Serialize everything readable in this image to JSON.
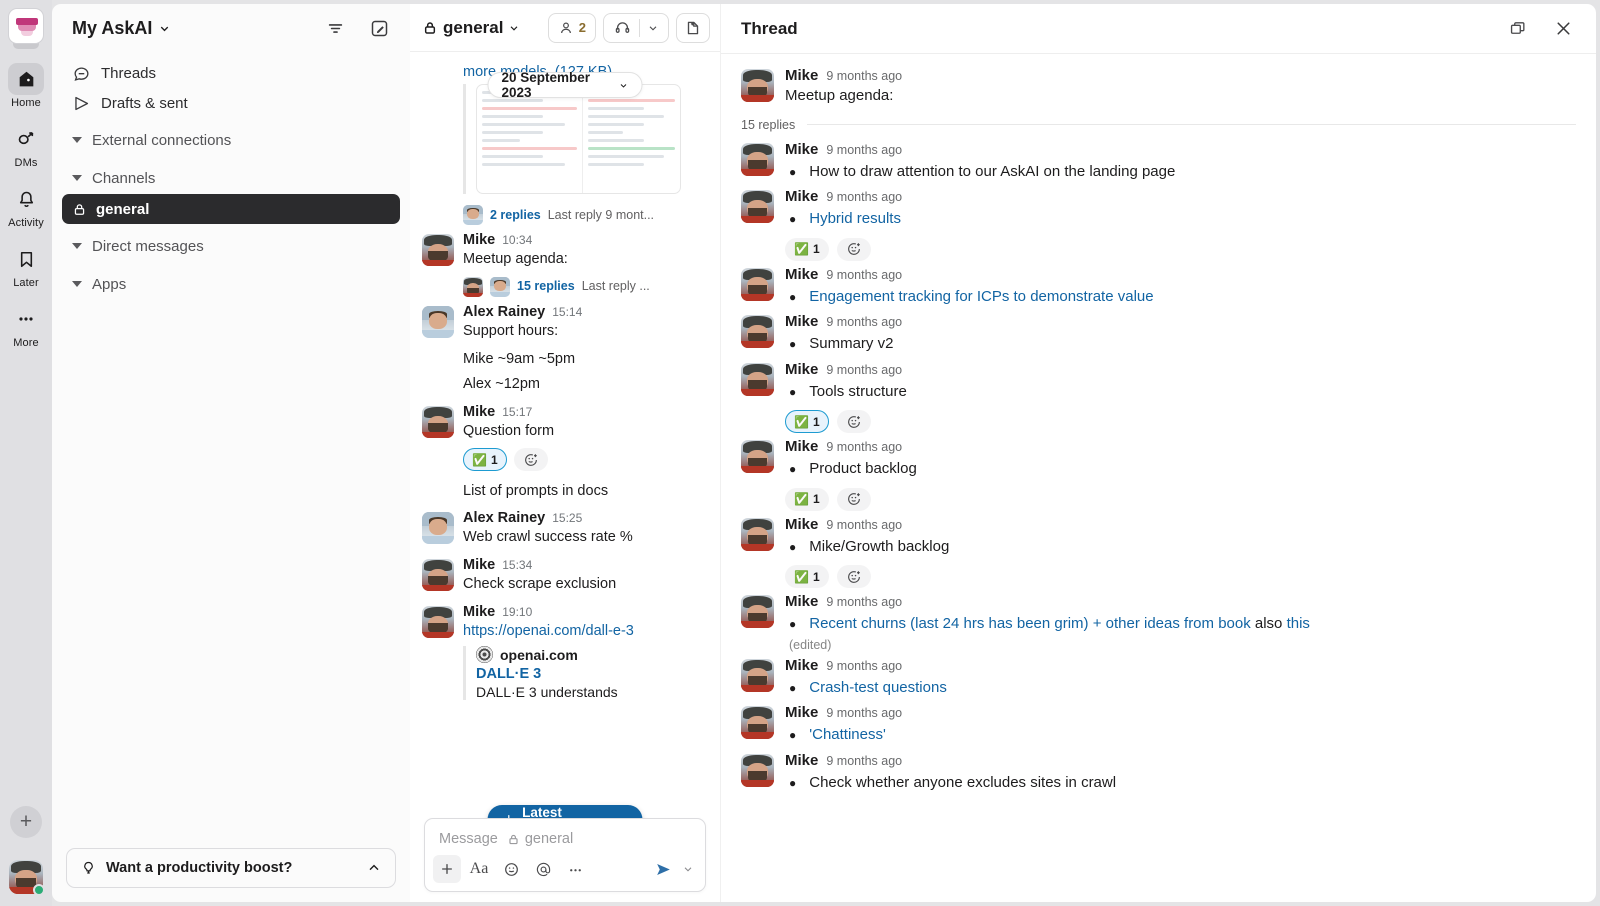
{
  "rail": {
    "workspace_logo": "askai-workspace-logo",
    "items": [
      {
        "label": "Home",
        "icon": "home-icon",
        "active": true
      },
      {
        "label": "DMs",
        "icon": "dms-icon",
        "active": false
      },
      {
        "label": "Activity",
        "icon": "bell-icon",
        "active": false
      },
      {
        "label": "Later",
        "icon": "bookmark-icon",
        "active": false
      },
      {
        "label": "More",
        "icon": "ellipsis-icon",
        "active": false
      }
    ],
    "new_button": "+",
    "avatar": "user-avatar"
  },
  "sidebar": {
    "workspace_name": "My AskAI",
    "filter_icon": "filter-icon",
    "compose_icon": "compose-icon",
    "quick_links": [
      {
        "label": "Threads",
        "icon": "threads-icon"
      },
      {
        "label": "Drafts & sent",
        "icon": "send-icon"
      }
    ],
    "sections": [
      {
        "label": "External connections",
        "expanded": true
      },
      {
        "label": "Channels",
        "expanded": true
      },
      {
        "label": "Direct messages",
        "expanded": true
      },
      {
        "label": "Apps",
        "expanded": true
      }
    ],
    "channels": [
      {
        "name": "general",
        "private": true,
        "selected": true
      }
    ],
    "boost_banner": {
      "label": "Want a productivity boost?",
      "icon": "lightbulb-icon",
      "chevron": "chevron-up-icon"
    }
  },
  "channel": {
    "name": "general",
    "private": true,
    "member_count": "2",
    "huddle_icon": "headphones-icon",
    "canvas_icon": "add-canvas-icon",
    "date_divider": "20 September 2023",
    "truncated_top_text": "more models. (127 KB)",
    "messages": [
      {
        "type": "attachment_replies",
        "replies_count": "2 replies",
        "last_reply": "Last reply 9 mont..."
      },
      {
        "author": "Mike",
        "avatar": "mike",
        "time": "10:34",
        "text": "Meetup agenda:",
        "replies_count": "15 replies",
        "last_reply": "Last reply ..."
      },
      {
        "author": "Alex Rainey",
        "avatar": "alex",
        "time": "15:14",
        "text": "Support hours:",
        "continuations": [
          "Mike ~9am ~5pm",
          "Alex ~12pm"
        ]
      },
      {
        "author": "Mike",
        "avatar": "mike",
        "time": "15:17",
        "text": "Question form",
        "reaction": {
          "emoji": "✅",
          "count": "1",
          "selected": true
        },
        "continuations": [
          "List of prompts in docs"
        ]
      },
      {
        "author": "Alex Rainey",
        "avatar": "alex",
        "time": "15:25",
        "text": "Web crawl success rate %"
      },
      {
        "author": "Mike",
        "avatar": "mike",
        "time": "15:34",
        "text": "Check scrape exclusion"
      },
      {
        "author": "Mike",
        "avatar": "mike",
        "time": "19:10",
        "link": "https://openai.com/dall-e-3",
        "preview": {
          "site": "openai.com",
          "title": "DALL·E 3",
          "desc": "DALL·E 3 understands"
        }
      }
    ],
    "latest_button": "Latest messages",
    "composer": {
      "placeholder_prefix": "Message",
      "placeholder_channel": "general",
      "icons": [
        "plus-icon",
        "formatting-icon",
        "emoji-icon",
        "mention-icon",
        "more-icon",
        "send-icon",
        "send-options-icon"
      ]
    }
  },
  "thread": {
    "title": "Thread",
    "expand_icon": "split-view-icon",
    "close_icon": "close-icon",
    "root": {
      "author": "Mike",
      "avatar": "mike",
      "time": "9 months ago",
      "text": "Meetup agenda:"
    },
    "replies_label": "15 replies",
    "replies": [
      {
        "author": "Mike",
        "time": "9 months ago",
        "bullet": "How to draw attention to our AskAI on the landing page",
        "is_link": false
      },
      {
        "author": "Mike",
        "time": "9 months ago",
        "bullet": "Hybrid results",
        "is_link": true,
        "reaction": {
          "emoji": "✅",
          "count": "1",
          "selected": false
        }
      },
      {
        "author": "Mike",
        "time": "9 months ago",
        "bullet": "Engagement tracking for ICPs to demonstrate value",
        "is_link": true
      },
      {
        "author": "Mike",
        "time": "9 months ago",
        "bullet": "Summary v2",
        "is_link": false
      },
      {
        "author": "Mike",
        "time": "9 months ago",
        "bullet": "Tools structure",
        "is_link": false,
        "reaction": {
          "emoji": "✅",
          "count": "1",
          "selected": true
        }
      },
      {
        "author": "Mike",
        "time": "9 months ago",
        "bullet": "Product backlog",
        "is_link": false,
        "reaction": {
          "emoji": "✅",
          "count": "1",
          "selected": false
        }
      },
      {
        "author": "Mike",
        "time": "9 months ago",
        "bullet": "Mike/Growth backlog",
        "is_link": false,
        "reaction": {
          "emoji": "✅",
          "count": "1",
          "selected": false
        }
      },
      {
        "author": "Mike",
        "time": "9 months ago",
        "bullet": "Recent churns (last 24 hrs has been grim) + other ideas from book",
        "bullet_tail_plain": " also ",
        "bullet_tail_link": "this",
        "is_link": true,
        "edited": "(edited)"
      },
      {
        "author": "Mike",
        "time": "9 months ago",
        "bullet": "Crash-test questions",
        "is_link": true
      },
      {
        "author": "Mike",
        "time": "9 months ago",
        "bullet": "'Chattiness'",
        "is_link": true
      },
      {
        "author": "Mike",
        "time": "9 months ago",
        "bullet": "Check whether anyone excludes sites in crawl",
        "is_link": false
      }
    ]
  },
  "colors": {
    "accent_blue": "#1264a3",
    "selected_channel_bg": "#2b2b2d",
    "rail_bg": "#e0e0e3",
    "reaction_selected_border": "#1d9bd1",
    "presence_green": "#2bac76"
  }
}
